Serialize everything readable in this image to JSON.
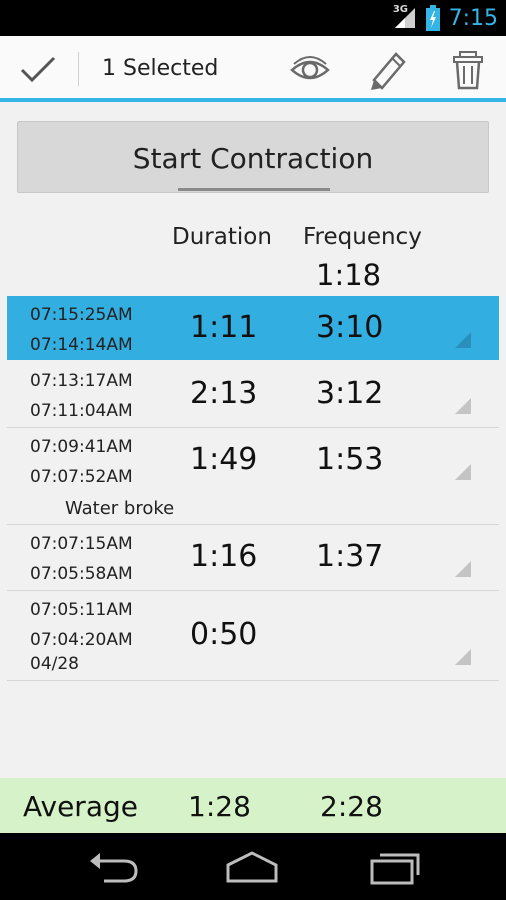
{
  "statusbar": {
    "network": "3G",
    "time": "7:15",
    "colors": {
      "accent": "#33b5e5"
    }
  },
  "actionbar": {
    "title": "1 Selected",
    "icons": [
      "check-icon",
      "eye-icon",
      "pencil-icon",
      "trash-icon"
    ]
  },
  "start_button": {
    "label": "Start Contraction"
  },
  "columns": {
    "duration": "Duration",
    "frequency": "Frequency",
    "frequency_value": "1:18"
  },
  "rows": [
    {
      "start": "07:15:25AM",
      "end": "07:14:14AM",
      "date": "",
      "duration": "1:11",
      "frequency": "3:10",
      "note": "",
      "selected": true
    },
    {
      "start": "07:13:17AM",
      "end": "07:11:04AM",
      "date": "",
      "duration": "2:13",
      "frequency": "3:12",
      "note": "",
      "selected": false
    },
    {
      "start": "07:09:41AM",
      "end": "07:07:52AM",
      "date": "",
      "duration": "1:49",
      "frequency": "1:53",
      "note": "Water broke",
      "selected": false
    },
    {
      "start": "07:07:15AM",
      "end": "07:05:58AM",
      "date": "",
      "duration": "1:16",
      "frequency": "1:37",
      "note": "",
      "selected": false
    },
    {
      "start": "07:05:11AM",
      "end": "07:04:20AM",
      "date": "04/28",
      "duration": "0:50",
      "frequency": "",
      "note": "",
      "selected": false
    }
  ],
  "average": {
    "label": "Average",
    "duration": "1:28",
    "frequency": "2:28"
  },
  "navbar": {
    "icons": [
      "back-icon",
      "home-icon",
      "recent-apps-icon"
    ]
  },
  "colors": {
    "selected_row": "#33aee0",
    "average_bar": "#d6f2c9",
    "accent_line": "#33b5e5"
  }
}
